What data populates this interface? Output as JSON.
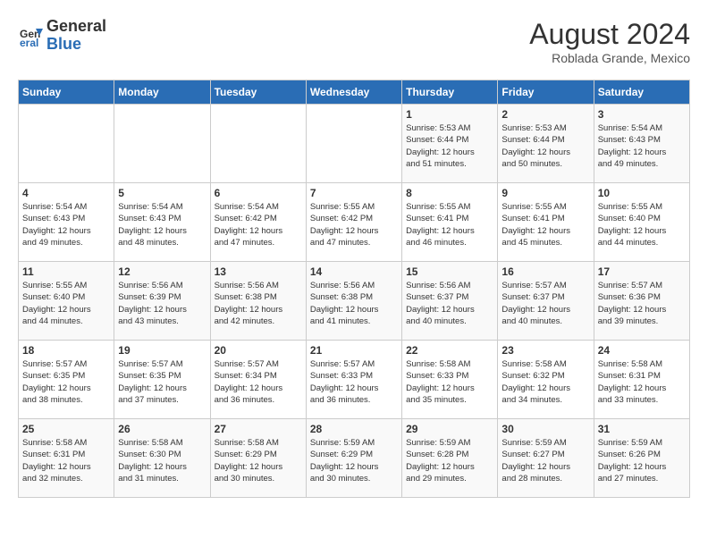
{
  "header": {
    "logo": {
      "line1": "General",
      "line2": "Blue"
    },
    "title": "August 2024",
    "subtitle": "Roblada Grande, Mexico"
  },
  "weekdays": [
    "Sunday",
    "Monday",
    "Tuesday",
    "Wednesday",
    "Thursday",
    "Friday",
    "Saturday"
  ],
  "weeks": [
    [
      {
        "day": "",
        "info": ""
      },
      {
        "day": "",
        "info": ""
      },
      {
        "day": "",
        "info": ""
      },
      {
        "day": "",
        "info": ""
      },
      {
        "day": "1",
        "info": "Sunrise: 5:53 AM\nSunset: 6:44 PM\nDaylight: 12 hours\nand 51 minutes."
      },
      {
        "day": "2",
        "info": "Sunrise: 5:53 AM\nSunset: 6:44 PM\nDaylight: 12 hours\nand 50 minutes."
      },
      {
        "day": "3",
        "info": "Sunrise: 5:54 AM\nSunset: 6:43 PM\nDaylight: 12 hours\nand 49 minutes."
      }
    ],
    [
      {
        "day": "4",
        "info": "Sunrise: 5:54 AM\nSunset: 6:43 PM\nDaylight: 12 hours\nand 49 minutes."
      },
      {
        "day": "5",
        "info": "Sunrise: 5:54 AM\nSunset: 6:43 PM\nDaylight: 12 hours\nand 48 minutes."
      },
      {
        "day": "6",
        "info": "Sunrise: 5:54 AM\nSunset: 6:42 PM\nDaylight: 12 hours\nand 47 minutes."
      },
      {
        "day": "7",
        "info": "Sunrise: 5:55 AM\nSunset: 6:42 PM\nDaylight: 12 hours\nand 47 minutes."
      },
      {
        "day": "8",
        "info": "Sunrise: 5:55 AM\nSunset: 6:41 PM\nDaylight: 12 hours\nand 46 minutes."
      },
      {
        "day": "9",
        "info": "Sunrise: 5:55 AM\nSunset: 6:41 PM\nDaylight: 12 hours\nand 45 minutes."
      },
      {
        "day": "10",
        "info": "Sunrise: 5:55 AM\nSunset: 6:40 PM\nDaylight: 12 hours\nand 44 minutes."
      }
    ],
    [
      {
        "day": "11",
        "info": "Sunrise: 5:55 AM\nSunset: 6:40 PM\nDaylight: 12 hours\nand 44 minutes."
      },
      {
        "day": "12",
        "info": "Sunrise: 5:56 AM\nSunset: 6:39 PM\nDaylight: 12 hours\nand 43 minutes."
      },
      {
        "day": "13",
        "info": "Sunrise: 5:56 AM\nSunset: 6:38 PM\nDaylight: 12 hours\nand 42 minutes."
      },
      {
        "day": "14",
        "info": "Sunrise: 5:56 AM\nSunset: 6:38 PM\nDaylight: 12 hours\nand 41 minutes."
      },
      {
        "day": "15",
        "info": "Sunrise: 5:56 AM\nSunset: 6:37 PM\nDaylight: 12 hours\nand 40 minutes."
      },
      {
        "day": "16",
        "info": "Sunrise: 5:57 AM\nSunset: 6:37 PM\nDaylight: 12 hours\nand 40 minutes."
      },
      {
        "day": "17",
        "info": "Sunrise: 5:57 AM\nSunset: 6:36 PM\nDaylight: 12 hours\nand 39 minutes."
      }
    ],
    [
      {
        "day": "18",
        "info": "Sunrise: 5:57 AM\nSunset: 6:35 PM\nDaylight: 12 hours\nand 38 minutes."
      },
      {
        "day": "19",
        "info": "Sunrise: 5:57 AM\nSunset: 6:35 PM\nDaylight: 12 hours\nand 37 minutes."
      },
      {
        "day": "20",
        "info": "Sunrise: 5:57 AM\nSunset: 6:34 PM\nDaylight: 12 hours\nand 36 minutes."
      },
      {
        "day": "21",
        "info": "Sunrise: 5:57 AM\nSunset: 6:33 PM\nDaylight: 12 hours\nand 36 minutes."
      },
      {
        "day": "22",
        "info": "Sunrise: 5:58 AM\nSunset: 6:33 PM\nDaylight: 12 hours\nand 35 minutes."
      },
      {
        "day": "23",
        "info": "Sunrise: 5:58 AM\nSunset: 6:32 PM\nDaylight: 12 hours\nand 34 minutes."
      },
      {
        "day": "24",
        "info": "Sunrise: 5:58 AM\nSunset: 6:31 PM\nDaylight: 12 hours\nand 33 minutes."
      }
    ],
    [
      {
        "day": "25",
        "info": "Sunrise: 5:58 AM\nSunset: 6:31 PM\nDaylight: 12 hours\nand 32 minutes."
      },
      {
        "day": "26",
        "info": "Sunrise: 5:58 AM\nSunset: 6:30 PM\nDaylight: 12 hours\nand 31 minutes."
      },
      {
        "day": "27",
        "info": "Sunrise: 5:58 AM\nSunset: 6:29 PM\nDaylight: 12 hours\nand 30 minutes."
      },
      {
        "day": "28",
        "info": "Sunrise: 5:59 AM\nSunset: 6:29 PM\nDaylight: 12 hours\nand 30 minutes."
      },
      {
        "day": "29",
        "info": "Sunrise: 5:59 AM\nSunset: 6:28 PM\nDaylight: 12 hours\nand 29 minutes."
      },
      {
        "day": "30",
        "info": "Sunrise: 5:59 AM\nSunset: 6:27 PM\nDaylight: 12 hours\nand 28 minutes."
      },
      {
        "day": "31",
        "info": "Sunrise: 5:59 AM\nSunset: 6:26 PM\nDaylight: 12 hours\nand 27 minutes."
      }
    ]
  ]
}
